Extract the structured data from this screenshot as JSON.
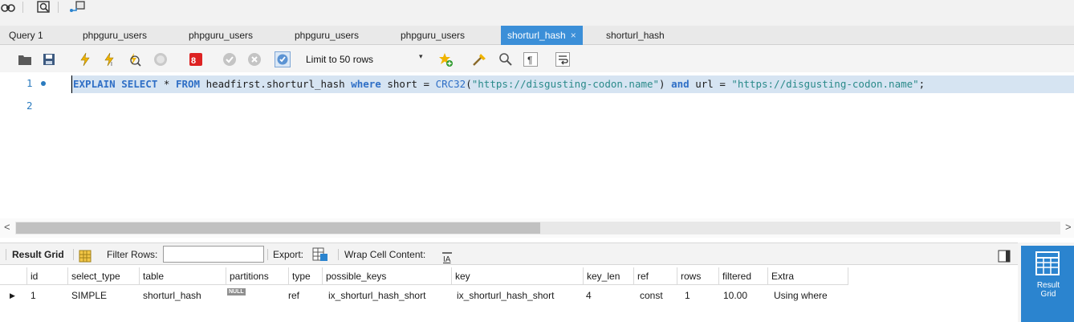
{
  "top_toolbar": {
    "icons": [
      "binoculars-icon",
      "inspect-icon",
      "connect-icon"
    ]
  },
  "tabs": [
    {
      "label": "Query 1",
      "active": false
    },
    {
      "label": "phpguru_users",
      "active": false
    },
    {
      "label": "phpguru_users",
      "active": false
    },
    {
      "label": "phpguru_users",
      "active": false
    },
    {
      "label": "phpguru_users",
      "active": false
    },
    {
      "label": "shorturl_hash",
      "active": true,
      "close": "×"
    },
    {
      "label": "shorturl_hash",
      "active": false
    }
  ],
  "editor_toolbar": {
    "limit_label": "Limit to 50 rows",
    "dropdown_arrow": "▾"
  },
  "editor": {
    "line_numbers": [
      "1",
      "2"
    ],
    "sql": {
      "t1": "EXPLAIN SELECT",
      "t2": " * ",
      "t3": "FROM",
      "t4": " headfirst.shorturl_hash ",
      "t5": "where",
      "t6": " short = ",
      "t7": "CRC32",
      "t8": "(",
      "t9": "\"https://disgusting-codon.name\"",
      "t10": ") ",
      "t11": "and",
      "t12": " url = ",
      "t13": "\"https://disgusting-codon.name\"",
      "t14": ";"
    }
  },
  "scrollbar": {
    "left_arrow": "<",
    "right_arrow": ">"
  },
  "result_toolbar": {
    "result_grid_label": "Result Grid",
    "filter_rows_label": "Filter Rows:",
    "filter_value": "",
    "export_label": "Export:",
    "wrap_label": "Wrap Cell Content:"
  },
  "grid": {
    "columns": [
      "id",
      "select_type",
      "table",
      "partitions",
      "type",
      "possible_keys",
      "key",
      "key_len",
      "ref",
      "rows",
      "filtered",
      "Extra"
    ],
    "row": {
      "marker": "▶",
      "id": "1",
      "select_type": "SIMPLE",
      "table": "shorturl_hash",
      "partitions": "NULL",
      "type": "ref",
      "possible_keys": "ix_shorturl_hash_short",
      "key": "ix_shorturl_hash_short",
      "key_len": "4",
      "ref": "const",
      "rows": "1",
      "filtered": "10.00",
      "Extra": "Using where"
    }
  },
  "side_panel": {
    "result_grid_button": "Result Grid"
  },
  "colors": {
    "accent": "#3b8fd8",
    "selection": "#d6e4f2",
    "keyword": "#2f6fc6",
    "string": "#2a8a8a"
  }
}
